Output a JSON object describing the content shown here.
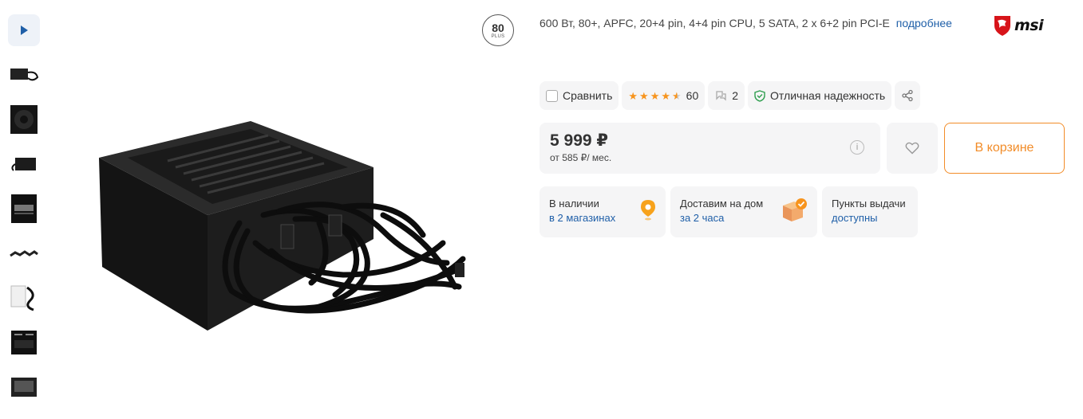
{
  "gallery": {
    "play_label": "play-video",
    "thumbnail_count": 8
  },
  "badge": {
    "number": "80",
    "plus": "PLUS"
  },
  "product": {
    "description": "600 Вт, 80+, APFC, 20+4 pin, 4+4 pin CPU, 5 SATA, 2 x 6+2 pin PCI-E",
    "details_link": "подробнее",
    "brand": "msi"
  },
  "actions": {
    "compare_label": "Сравнить",
    "rating": 4.5,
    "reviews_count": "60",
    "questions_count": "2",
    "reliability_label": "Отличная надежность"
  },
  "pricing": {
    "price": "5 999 ₽",
    "installment": "от 585 ₽/ мес.",
    "cart_label": "В корзине"
  },
  "availability": [
    {
      "title": "В наличии",
      "link": "в 2 магазинах",
      "icon": "map-pin-icon"
    },
    {
      "title": "Доставим на дом",
      "link": "за 2 часа",
      "icon": "delivery-box-icon"
    },
    {
      "title": "Пункты выдачи",
      "link": "доступны",
      "icon": ""
    }
  ],
  "colors": {
    "accent_orange": "#f28c28",
    "link_blue": "#1f5fa8",
    "chip_bg": "#f5f5f6",
    "star": "#f7941d",
    "shield_green": "#2e9e4f"
  }
}
